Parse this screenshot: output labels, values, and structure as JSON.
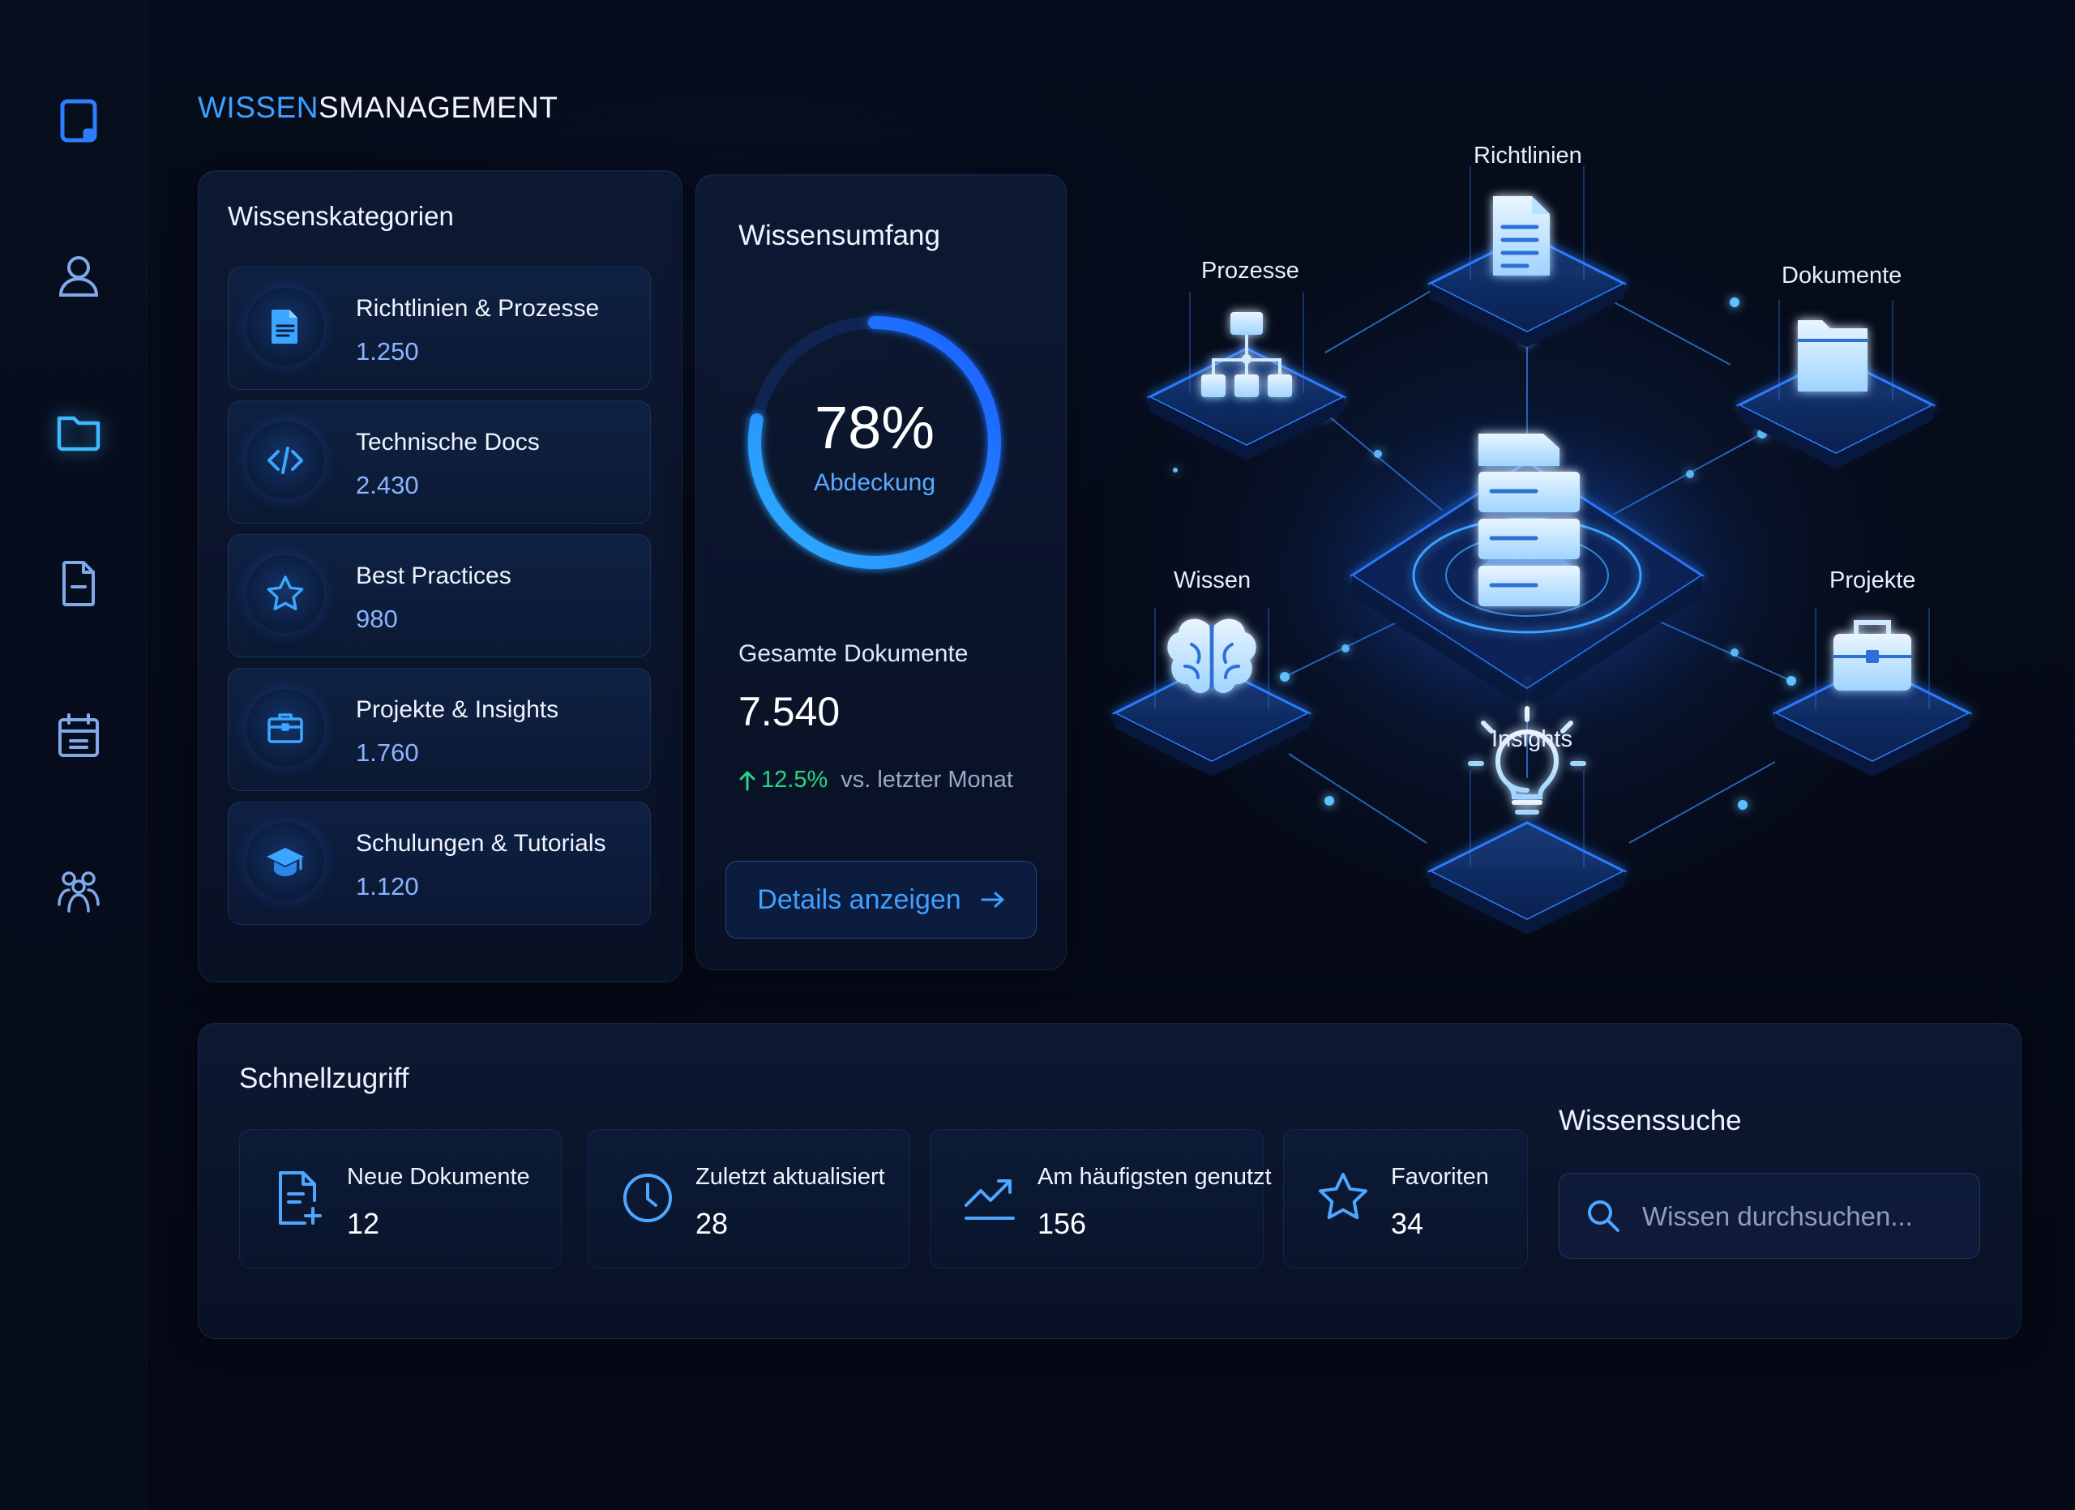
{
  "header": {
    "title_accent": "WISSEN",
    "title_rest": "SMANAGEMENT"
  },
  "sidebar": {
    "icons": [
      "tablet-icon",
      "user-icon",
      "folder-icon",
      "document-icon",
      "calendar-icon",
      "team-icon"
    ],
    "active": "folder-icon"
  },
  "categories": {
    "title": "Wissenskategorien",
    "items": [
      {
        "label": "Richtlinien & Prozesse",
        "value": "1.250",
        "icon": "document-icon"
      },
      {
        "label": "Technische Docs",
        "value": "2.430",
        "icon": "code-icon"
      },
      {
        "label": "Best Practices",
        "value": "980",
        "icon": "star-icon"
      },
      {
        "label": "Projekte & Insights",
        "value": "1.760",
        "icon": "briefcase-icon"
      },
      {
        "label": "Schulungen & Tutorials",
        "value": "1.120",
        "icon": "graduation-cap-icon"
      }
    ]
  },
  "scope": {
    "title": "Wissensumfang",
    "coverage_percent": 78,
    "coverage_text": "78%",
    "coverage_label": "Abdeckung",
    "total_label": "Gesamte Dokumente",
    "total_value": "7.540",
    "trend_value": "12.5%",
    "trend_text": "vs. letzter Monat",
    "details_button": "Details anzeigen"
  },
  "network": {
    "center_icon": "file-stack-icon",
    "nodes": [
      {
        "label": "Richtlinien",
        "icon": "document-icon"
      },
      {
        "label": "Prozesse",
        "icon": "hierarchy-icon"
      },
      {
        "label": "Dokumente",
        "icon": "folder-icon"
      },
      {
        "label": "Wissen",
        "icon": "brain-icon"
      },
      {
        "label": "Projekte",
        "icon": "briefcase-icon"
      },
      {
        "label": "Insights",
        "icon": "lightbulb-icon"
      }
    ]
  },
  "quick_access": {
    "title": "Schnellzugriff",
    "items": [
      {
        "label": "Neue Dokumente",
        "value": "12",
        "icon": "new-document-icon"
      },
      {
        "label": "Zuletzt aktualisiert",
        "value": "28",
        "icon": "clock-icon"
      },
      {
        "label": "Am häufigsten genutzt",
        "value": "156",
        "icon": "trend-chart-icon"
      },
      {
        "label": "Favoriten",
        "value": "34",
        "icon": "star-icon"
      }
    ]
  },
  "search": {
    "title": "Wissenssuche",
    "placeholder": "Wissen durchsuchen..."
  },
  "colors": {
    "accent": "#3ea0ff",
    "background": "#050a16",
    "panel": "#0e1a34",
    "trend_up": "#27d684"
  }
}
